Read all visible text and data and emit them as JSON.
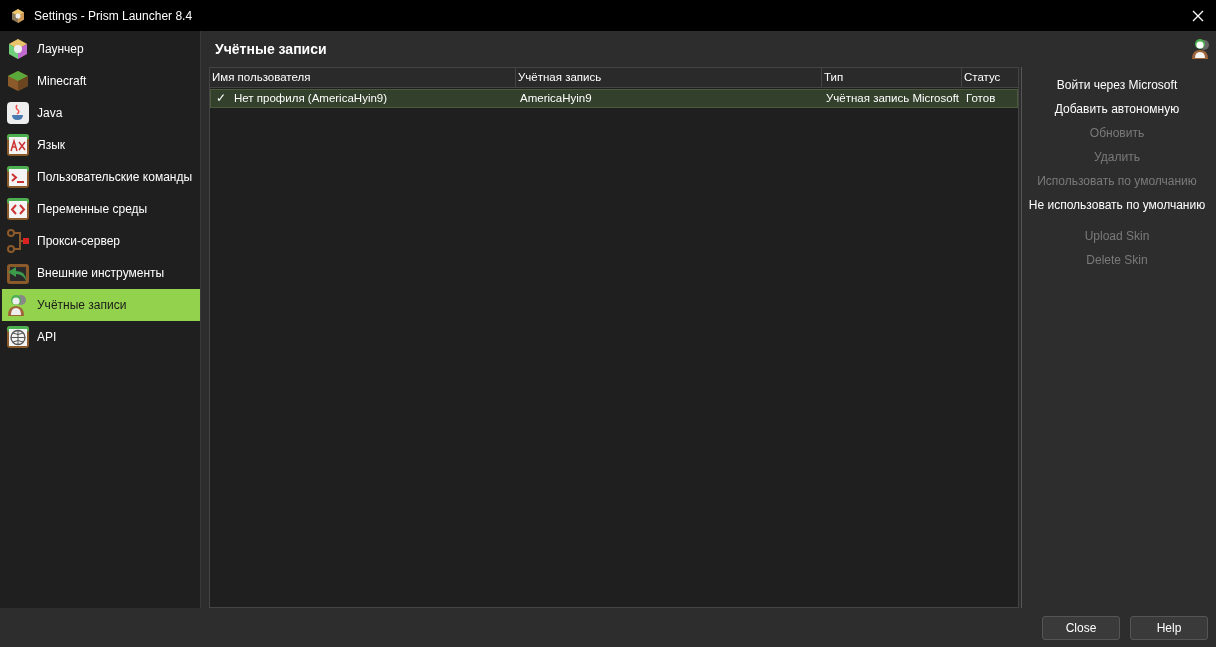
{
  "window": {
    "title": "Settings - Prism Launcher 8.4"
  },
  "sidebar": {
    "items": [
      {
        "label": "Лаунчер",
        "selected": false
      },
      {
        "label": "Minecraft",
        "selected": false
      },
      {
        "label": "Java",
        "selected": false
      },
      {
        "label": "Язык",
        "selected": false
      },
      {
        "label": "Пользовательские команды",
        "selected": false
      },
      {
        "label": "Переменные среды",
        "selected": false
      },
      {
        "label": "Прокси-сервер",
        "selected": false
      },
      {
        "label": "Внешние инструменты",
        "selected": false
      },
      {
        "label": "Учётные записи",
        "selected": true
      },
      {
        "label": "API",
        "selected": false
      }
    ]
  },
  "page": {
    "title": "Учётные записи"
  },
  "table": {
    "columns": [
      "Имя пользователя",
      "Учётная запись",
      "Тип",
      "Статус"
    ],
    "rows": [
      {
        "mark": "✓",
        "cells": [
          "Нет профиля (AmericaHyin9)",
          "AmericaHyin9",
          "Учётная запись Microsoft",
          "Готов"
        ],
        "selected": true
      }
    ]
  },
  "actions": [
    {
      "label": "Войти через Microsoft",
      "disabled": false
    },
    {
      "label": "Добавить автономную",
      "disabled": false
    },
    {
      "label": "Обновить",
      "disabled": true
    },
    {
      "label": "Удалить",
      "disabled": true
    },
    {
      "label": "Использовать по умолчанию",
      "disabled": true
    },
    {
      "label": "Не использовать по умолчанию",
      "disabled": false
    },
    {
      "label": "Upload Skin",
      "disabled": true
    },
    {
      "label": "Delete Skin",
      "disabled": true
    }
  ],
  "buttons": [
    "Close",
    "Help"
  ]
}
